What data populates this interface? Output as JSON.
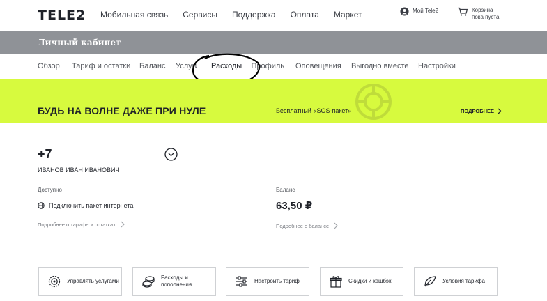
{
  "header": {
    "logo": "TELE2",
    "nav": [
      "Мобильная связь",
      "Сервисы",
      "Поддержка",
      "Оплата",
      "Маркет"
    ],
    "account_label": "Мой Tele2",
    "cart_label": "Корзина пока пуста"
  },
  "cabinet": {
    "title": "Личный кабинет"
  },
  "subnav": {
    "items": [
      "Обзор",
      "Тариф и остатки",
      "Баланс",
      "Услуги",
      "Расходы",
      "Профиль",
      "Оповещения",
      "Выгодно вместе",
      "Настройки"
    ],
    "active": "Расходы"
  },
  "banner": {
    "title": "БУДЬ НА ВОЛНЕ ДАЖЕ ПРИ НУЛЕ",
    "subtitle": "Бесплатный «SOS-пакет»",
    "more_label": "ПОДРОБНЕЕ",
    "bg_color": "#d7fa3e"
  },
  "profile": {
    "phone": "+7",
    "name": "ИВАНОВ ИВАН ИВАНОВИЧ"
  },
  "available": {
    "label": "Доступно",
    "connect_text": "Подключить пакет интернета",
    "link": "Подробнее о тарифе и остатках"
  },
  "balance": {
    "label": "Баланс",
    "value": "63,50 ₽",
    "link": "Подробнее о балансе"
  },
  "cards": [
    {
      "icon": "gear-services-icon",
      "label": "Управлять услугами"
    },
    {
      "icon": "coins-icon",
      "label": "Расходы и пополнения"
    },
    {
      "icon": "sliders-icon",
      "label": "Настроить тариф"
    },
    {
      "icon": "gift-icon",
      "label": "Скидки и кэшбэк"
    },
    {
      "icon": "leaf-icon",
      "label": "Условия тарифа"
    }
  ]
}
